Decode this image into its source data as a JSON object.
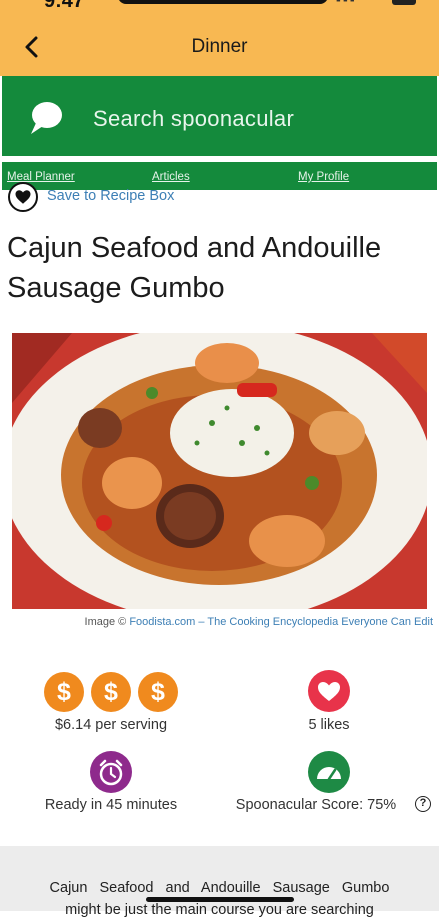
{
  "status_bar": {
    "time": "9:47"
  },
  "header": {
    "title": "Dinner",
    "back_label": "Back"
  },
  "search": {
    "placeholder": "Search spoonacular"
  },
  "nav": {
    "items": [
      "Meal Planner",
      "Articles",
      "My Profile"
    ]
  },
  "save": {
    "label": "Save to Recipe Box"
  },
  "recipe": {
    "title": "Cajun Seafood and Andouille Sausage Gumbo",
    "image_credit_prefix": "Image ©",
    "image_credit_link": "Foodista.com – The Cooking Encyclopedia Everyone Can Edit"
  },
  "stats": {
    "price_symbols": [
      "$",
      "$",
      "$"
    ],
    "price_label": "$6.14 per serving",
    "likes_label": "5 likes",
    "ready_label": "Ready in 45 minutes",
    "score_label": "Spoonacular Score: 75%",
    "help_symbol": "?"
  },
  "description": {
    "line1": "Cajun Seafood and Andouille Sausage Gumbo",
    "line2": "might be just the main course you are searching"
  },
  "colors": {
    "header": "#f8b852",
    "search_green": "#148a3c",
    "coin_orange": "#f08a1e",
    "likes_red": "#e8334a",
    "clock_purple": "#8e2a8c",
    "score_green": "#1e8a45",
    "link_blue": "#3d7fb5"
  }
}
